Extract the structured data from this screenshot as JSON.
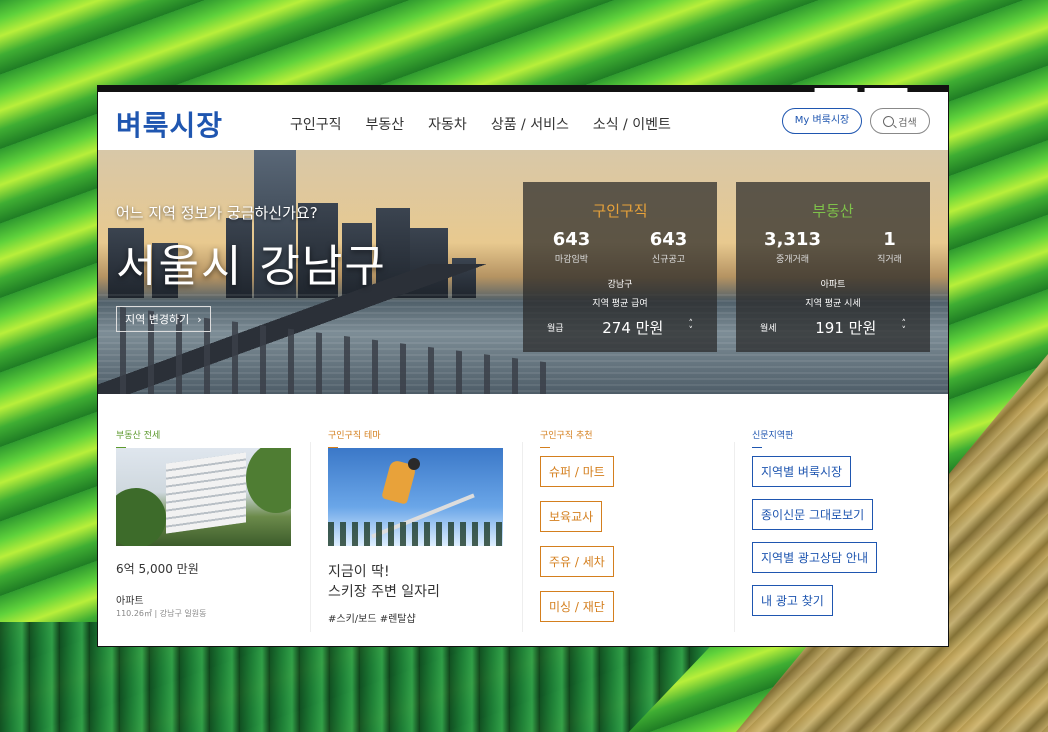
{
  "header": {
    "logo": "벼룩시장",
    "nav": [
      "구인구직",
      "부동산",
      "자동차",
      "상품 / 서비스",
      "소식 / 이벤트"
    ],
    "my_button": "My 벼룩시장",
    "search_button": "검색"
  },
  "hero": {
    "question": "어느 지역 정보가 궁금하신가요?",
    "region": "서울시 강남구",
    "change_button": "지역 변경하기",
    "jobs": {
      "title": "구인구직",
      "stats": [
        {
          "value": "643",
          "label": "마감임박"
        },
        {
          "value": "643",
          "label": "신규공고"
        }
      ],
      "area": "강남구",
      "subtitle": "지역 평균 급여",
      "bottom_label": "월급",
      "bottom_value": "274 만원"
    },
    "estate": {
      "title": "부동산",
      "stats": [
        {
          "value": "3,313",
          "label": "중개거래"
        },
        {
          "value": "1",
          "label": "직거래"
        }
      ],
      "area": "아파트",
      "subtitle": "지역 평균 시세",
      "bottom_label": "월세",
      "bottom_value": "191 만원"
    }
  },
  "sections": {
    "estate": {
      "title": "부동산 전세",
      "price": "6억 5,000 만원",
      "type": "아파트",
      "address": "110.26㎡ | 강남구 일원동"
    },
    "theme": {
      "title": "구인구직 테마",
      "headline_line1": "지금이 딱!",
      "headline_line2": "스키장 주변 일자리",
      "tags": "#스키/보드 #렌탈샵"
    },
    "recommend": {
      "title": "구인구직 추천",
      "buttons": [
        "슈퍼 / 마트",
        "보육교사",
        "주유 / 세차",
        "미싱 / 재단"
      ]
    },
    "newspaper": {
      "title": "신문지역판",
      "buttons": [
        "지역별 벼룩시장",
        "종이신문 그대로보기",
        "지역별 광고상담 안내",
        "내 광고 찾기"
      ]
    }
  }
}
